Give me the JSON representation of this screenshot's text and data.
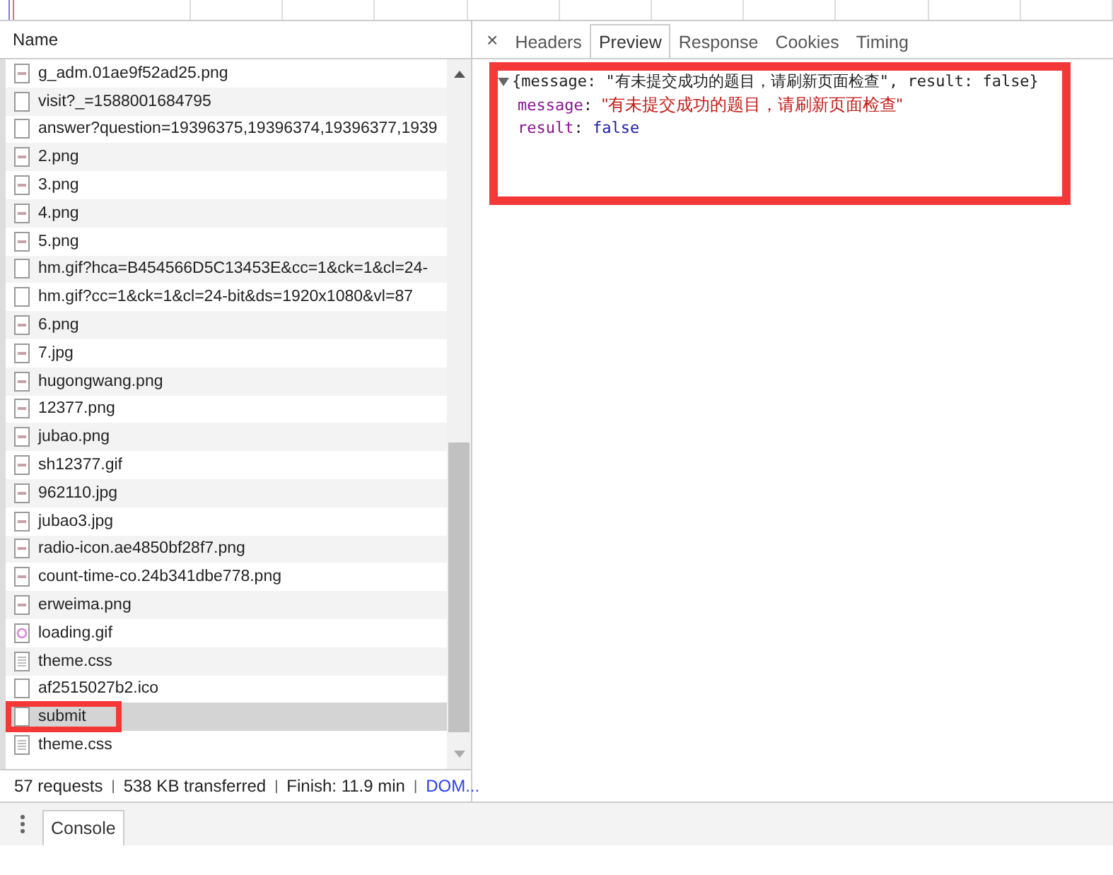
{
  "requests": {
    "column_header": "Name",
    "rows": [
      {
        "name": "g_adm.01ae9f52ad25.png",
        "kind": "image",
        "selected": false,
        "outlined": false
      },
      {
        "name": "visit?_=1588001684795",
        "kind": "document",
        "selected": false,
        "outlined": false
      },
      {
        "name": "answer?question=19396375,19396374,19396377,1939",
        "kind": "document",
        "selected": false,
        "outlined": false
      },
      {
        "name": "2.png",
        "kind": "image",
        "selected": false,
        "outlined": false
      },
      {
        "name": "3.png",
        "kind": "image",
        "selected": false,
        "outlined": false
      },
      {
        "name": "4.png",
        "kind": "image",
        "selected": false,
        "outlined": false
      },
      {
        "name": "5.png",
        "kind": "image",
        "selected": false,
        "outlined": false
      },
      {
        "name": "hm.gif?hca=B454566D5C13453E&cc=1&ck=1&cl=24-",
        "kind": "document",
        "selected": false,
        "outlined": false
      },
      {
        "name": "hm.gif?cc=1&ck=1&cl=24-bit&ds=1920x1080&vl=87",
        "kind": "document",
        "selected": false,
        "outlined": false
      },
      {
        "name": "6.png",
        "kind": "image",
        "selected": false,
        "outlined": false
      },
      {
        "name": "7.jpg",
        "kind": "image",
        "selected": false,
        "outlined": false
      },
      {
        "name": "hugongwang.png",
        "kind": "image",
        "selected": false,
        "outlined": false
      },
      {
        "name": "12377.png",
        "kind": "image",
        "selected": false,
        "outlined": false
      },
      {
        "name": "jubao.png",
        "kind": "image",
        "selected": false,
        "outlined": false
      },
      {
        "name": "sh12377.gif",
        "kind": "image",
        "selected": false,
        "outlined": false
      },
      {
        "name": "962110.jpg",
        "kind": "image",
        "selected": false,
        "outlined": false
      },
      {
        "name": "jubao3.jpg",
        "kind": "image",
        "selected": false,
        "outlined": false
      },
      {
        "name": "radio-icon.ae4850bf28f7.png",
        "kind": "image",
        "selected": false,
        "outlined": false
      },
      {
        "name": "count-time-co.24b341dbe778.png",
        "kind": "image",
        "selected": false,
        "outlined": false
      },
      {
        "name": "erweima.png",
        "kind": "image",
        "selected": false,
        "outlined": false
      },
      {
        "name": "loading.gif",
        "kind": "spinner",
        "selected": false,
        "outlined": false
      },
      {
        "name": "theme.css",
        "kind": "stylesheet",
        "selected": false,
        "outlined": false
      },
      {
        "name": "af2515027b2.ico",
        "kind": "document",
        "selected": false,
        "outlined": false
      },
      {
        "name": "submit",
        "kind": "document",
        "selected": true,
        "outlined": true
      },
      {
        "name": "theme.css",
        "kind": "stylesheet",
        "selected": false,
        "outlined": false
      }
    ]
  },
  "status_bar": {
    "items": [
      "57 requests",
      "538 KB transferred",
      "Finish: 11.9 min"
    ],
    "separator": "|",
    "link": "DOM..."
  },
  "detail": {
    "close": "×",
    "tabs": [
      {
        "label": "Headers",
        "selected": false
      },
      {
        "label": "Preview",
        "selected": true
      },
      {
        "label": "Response",
        "selected": false
      },
      {
        "label": "Cookies",
        "selected": false
      },
      {
        "label": "Timing",
        "selected": false
      }
    ],
    "preview": {
      "outlined": true,
      "colon": ":",
      "expanded": true,
      "summary": "{message: \"有未提交成功的题目，请刷新页面检查\", result: false}",
      "properties": [
        {
          "key": "message",
          "value": "\"有未提交成功的题目，请刷新页面检查\"",
          "kind": "string"
        },
        {
          "key": "result",
          "value": "false",
          "kind": "boolean"
        }
      ]
    }
  },
  "drawer": {
    "tabs": [
      {
        "label": "Console",
        "selected": true
      }
    ]
  }
}
